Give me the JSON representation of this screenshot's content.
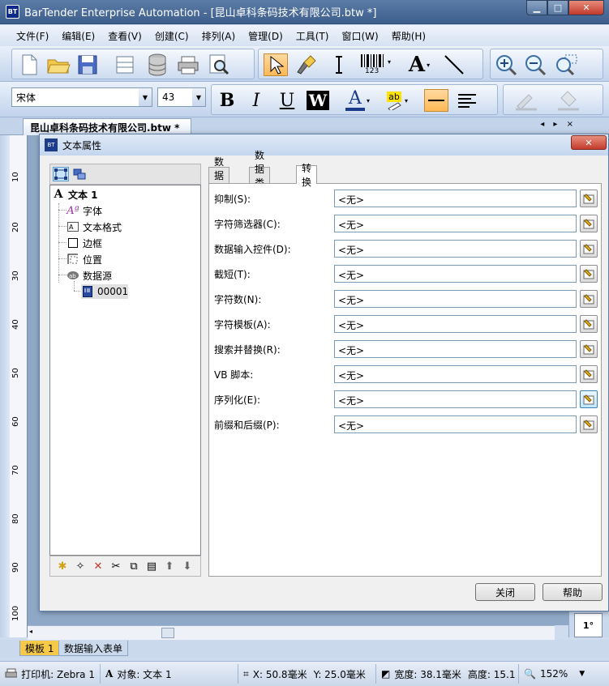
{
  "window": {
    "title": "BarTender Enterprise Automation - [昆山卓科条码技术有限公司.btw *]",
    "app_icon": "BT"
  },
  "menu": [
    "文件(F)",
    "编辑(E)",
    "查看(V)",
    "创建(C)",
    "排列(A)",
    "管理(D)",
    "工具(T)",
    "窗口(W)",
    "帮助(H)"
  ],
  "toolbar": {
    "font_name": "宋体",
    "font_size": "43",
    "bold": "B",
    "italic": "I",
    "underline": "U",
    "wordart": "W",
    "font_color": "A",
    "highlight": "ab",
    "text_a": "A",
    "barcode_num": "123"
  },
  "document_tab": "昆山卓科条码技术有限公司.btw *",
  "document_tab_nav": "◂ ▸ ×",
  "ruler_labels": [
    "10",
    "20",
    "30",
    "40",
    "50",
    "60",
    "70",
    "80",
    "90",
    "100"
  ],
  "dialog": {
    "title": "文本属性",
    "tree": {
      "root": "文本 1",
      "root_icon": "A",
      "children": [
        "字体",
        "文本格式",
        "边框",
        "位置",
        "数据源"
      ],
      "grandchild": "00001"
    },
    "tabs": [
      "数据源",
      "数据类型",
      "转换"
    ],
    "active_tab": "转换",
    "rows": [
      {
        "label": "抑制(S):",
        "value": "<无>"
      },
      {
        "label": "字符筛选器(C):",
        "value": "<无>"
      },
      {
        "label": "数据输入控件(D):",
        "value": "<无>"
      },
      {
        "label": "截短(T):",
        "value": "<无>"
      },
      {
        "label": "字符数(N):",
        "value": "<无>"
      },
      {
        "label": "字符模板(A):",
        "value": "<无>"
      },
      {
        "label": "搜索并替换(R):",
        "value": "<无>"
      },
      {
        "label": "VB 脚本:",
        "value": "<无>"
      },
      {
        "label": "序列化(E):",
        "value": "<无>"
      },
      {
        "label": "前缀和后缀(P):",
        "value": "<无>"
      }
    ],
    "close_button": "关闭",
    "help_button": "帮助"
  },
  "rotation": "1°",
  "bottom_tabs": [
    "模板 1",
    "数据输入表单"
  ],
  "status": {
    "printer": "打印机: Zebra 1",
    "object": "对象: 文本 1",
    "x": "X: 50.8毫米",
    "y": "Y: 25.0毫米",
    "width": "宽度: 38.1毫米",
    "height": "高度: 15.1",
    "zoom": "152%"
  }
}
